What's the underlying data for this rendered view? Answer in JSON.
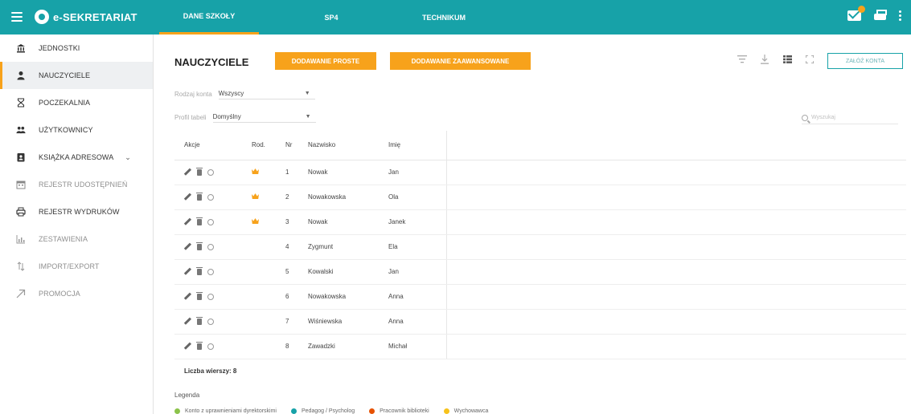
{
  "topbar": {
    "brand": "e-SEKRETARIAT",
    "tabs": [
      {
        "label": "DANE SZKOŁY",
        "active": true
      },
      {
        "label": "SP4",
        "active": false
      },
      {
        "label": "TECHNIKUM",
        "active": false
      }
    ],
    "accent": "#17a2a8",
    "highlight": "#f7a21b"
  },
  "sidebar": {
    "items": [
      {
        "label": "JEDNOSTKI",
        "icon": "bank-icon",
        "active": false,
        "dim": false
      },
      {
        "label": "NAUCZYCIELE",
        "icon": "person-icon",
        "active": true,
        "dim": false
      },
      {
        "label": "POCZEKALNIA",
        "icon": "hourglass-icon",
        "active": false,
        "dim": false
      },
      {
        "label": "UŻYTKOWNICY",
        "icon": "users-icon",
        "active": false,
        "dim": false
      },
      {
        "label": "KSIĄŻKA ADRESOWA",
        "icon": "address-book-icon",
        "active": false,
        "dim": false,
        "expandable": true
      },
      {
        "label": "REJESTR UDOSTĘPNIEŃ",
        "icon": "calendar-icon",
        "active": false,
        "dim": true
      },
      {
        "label": "REJESTR WYDRUKÓW",
        "icon": "printer-icon",
        "active": false,
        "dim": true
      },
      {
        "label": "ZESTAWIENIA",
        "icon": "bar-chart-icon",
        "active": false,
        "dim": true
      },
      {
        "label": "IMPORT/EXPORT",
        "icon": "import-export-icon",
        "active": false,
        "dim": true
      },
      {
        "label": "PROMOCJA",
        "icon": "promotion-icon",
        "active": false,
        "dim": true
      }
    ]
  },
  "main": {
    "title": "NAUCZYCIELE",
    "btn_simple": "DODAWANIE PROSTE",
    "btn_advanced": "DODAWANIE ZAAWANSOWANE",
    "btn_outline": "ZAŁÓŻ KONTA",
    "filters": {
      "account_type_label": "Rodzaj konta",
      "account_type_value": "Wszyscy",
      "profile_label": "Profil tabeli",
      "profile_value": "Domyślny"
    },
    "search_placeholder": "Wyszukaj"
  },
  "table": {
    "headers": [
      "Akcje",
      "Rod.",
      "Nr",
      "Nazwisko",
      "Imię"
    ],
    "rows": [
      {
        "crown": true,
        "nr": "1",
        "nazwisko": "Nowak",
        "imie": "Jan"
      },
      {
        "crown": true,
        "nr": "2",
        "nazwisko": "Nowakowska",
        "imie": "Ola"
      },
      {
        "crown": true,
        "nr": "3",
        "nazwisko": "Nowak",
        "imie": "Janek"
      },
      {
        "crown": false,
        "nr": "4",
        "nazwisko": "Zygmunt",
        "imie": "Ela"
      },
      {
        "crown": false,
        "nr": "5",
        "nazwisko": "Kowalski",
        "imie": "Jan"
      },
      {
        "crown": false,
        "nr": "6",
        "nazwisko": "Nowakowska",
        "imie": "Anna"
      },
      {
        "crown": false,
        "nr": "7",
        "nazwisko": "Wiśniewska",
        "imie": "Anna"
      },
      {
        "crown": false,
        "nr": "8",
        "nazwisko": "Zawadzki",
        "imie": "Michał"
      }
    ],
    "row_count_label": "Liczba wierszy:",
    "row_count": "8"
  },
  "legend": {
    "title": "Legenda",
    "items": [
      {
        "label": "Konto z uprawnieniami dyrektorskimi",
        "color": "#8bc34a"
      },
      {
        "label": "Pedagog / Psycholog",
        "color": "#17a2a8"
      },
      {
        "label": "Pracownik biblioteki",
        "color": "#e65100"
      },
      {
        "label": "Wychowawca",
        "color": "#f7c21b"
      }
    ]
  }
}
